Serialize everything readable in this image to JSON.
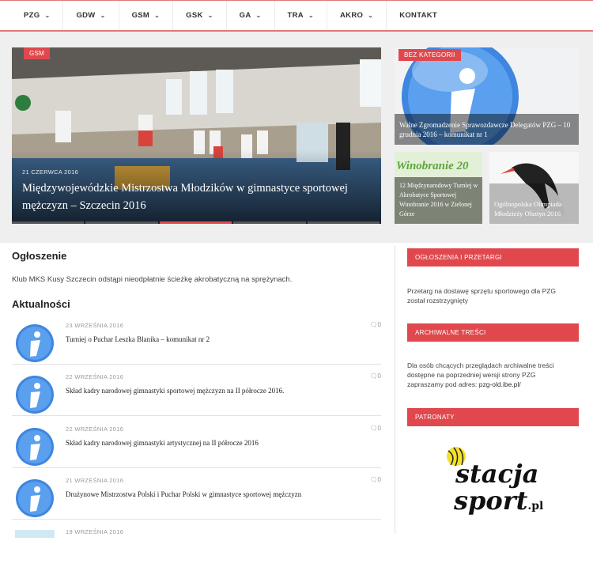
{
  "nav": {
    "items": [
      "PZG",
      "GDW",
      "GSM",
      "GSK",
      "GA",
      "TRA",
      "AKRO",
      "KONTAKT"
    ]
  },
  "slider": {
    "main": {
      "tag": "GSM",
      "date": "21 CZERWCA 2016",
      "title": "Międzywojewódzkie Mistrzostwa Młodzików w gimnastyce sportowej mężczyzn – Szczecin 2016"
    },
    "side": [
      {
        "tag": "BEZ KATEGORII",
        "title": "Walne Zgromadzenie Sprawozdawcze Delegatów PZG – 10 grudnia 2016 – komunikat nr 1"
      },
      {
        "logo_text": "Winobranie 20",
        "title": "12 Międzynarodowy Turniej w Akrobatyce Sportowej Winobranie 2016 w Zielonej Górze"
      },
      {
        "title": "Ogólnopolska Olimpiada Młodzieży Olsztyn 2016"
      }
    ]
  },
  "announcement": {
    "heading": "Ogłoszenie",
    "text": "Klub MKS Kusy Szczecin odstąpi nieodpłatnie ścieżkę akrobatyczną na sprężynach."
  },
  "news": {
    "heading": "Aktualności",
    "items": [
      {
        "date": "23 WRZEŚNIA 2016",
        "title": "Turniej o Puchar Leszka Blanika – komunikat nr 2",
        "comments": "0"
      },
      {
        "date": "22 WRZEŚNIA 2016",
        "title": "Skład kadry narodowej gimnastyki sportowej mężczyzn na II półrocze 2016.",
        "comments": "0"
      },
      {
        "date": "22 WRZEŚNIA 2016",
        "title": "Skład kadry narodowej gimnastyki artystycznej na II półrocze 2016",
        "comments": "0"
      },
      {
        "date": "21 WRZEŚNIA 2016",
        "title": "Drużynowe Mistrzostwa Polski i Puchar Polski w gimnastyce sportowej mężczyzn",
        "comments": "0"
      },
      {
        "date": "19 WRZEŚNIA 2016",
        "title": "",
        "comments": ""
      }
    ]
  },
  "sidebar": {
    "w1": {
      "title": "OGŁOSZENIA I PRZETARGI",
      "text": "Przetarg na dostawę sprzętu sportowego dla PZG został rozstrzygnięty"
    },
    "w2": {
      "title": "ARCHIWALNE TREŚCI",
      "text": "Dla osób chcących przeglądach archiwalne treści dostępne na poprzedniej wersji strony PZG zapraszamy pod adres: ",
      "link": "pzg-old.ibe.pl/"
    },
    "w3": {
      "title": "PATRONATY",
      "logo_line1": "stacja",
      "logo_line2": "sport",
      "logo_suffix": ".pl"
    }
  },
  "colors": {
    "accent": "#e0484e",
    "info_blue": "#3f86e0"
  }
}
